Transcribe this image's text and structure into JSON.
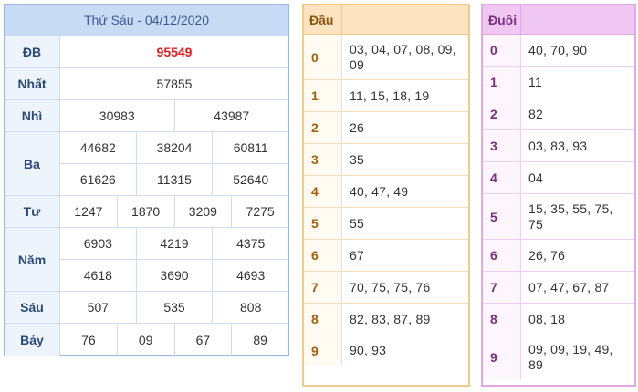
{
  "results": {
    "title": "Thứ Sáu - 04/12/2020",
    "prizes": [
      {
        "label": "ĐB",
        "rows": [
          [
            "95549"
          ]
        ]
      },
      {
        "label": "Nhất",
        "rows": [
          [
            "57855"
          ]
        ]
      },
      {
        "label": "Nhì",
        "rows": [
          [
            "30983",
            "43987"
          ]
        ]
      },
      {
        "label": "Ba",
        "rows": [
          [
            "44682",
            "38204",
            "60811"
          ],
          [
            "61626",
            "11315",
            "52640"
          ]
        ]
      },
      {
        "label": "Tư",
        "rows": [
          [
            "1247",
            "1870",
            "3209",
            "7275"
          ]
        ]
      },
      {
        "label": "Năm",
        "rows": [
          [
            "6903",
            "4219",
            "4375"
          ],
          [
            "4618",
            "3690",
            "4693"
          ]
        ]
      },
      {
        "label": "Sáu",
        "rows": [
          [
            "507",
            "535",
            "808"
          ]
        ]
      },
      {
        "label": "Bảy",
        "rows": [
          [
            "76",
            "09",
            "67",
            "89"
          ]
        ]
      }
    ]
  },
  "dau": {
    "header": "Đầu",
    "rows": [
      {
        "key": "0",
        "values": "03, 04, 07, 08, 09, 09"
      },
      {
        "key": "1",
        "values": "11, 15, 18, 19"
      },
      {
        "key": "2",
        "values": "26"
      },
      {
        "key": "3",
        "values": "35"
      },
      {
        "key": "4",
        "values": "40, 47, 49"
      },
      {
        "key": "5",
        "values": "55"
      },
      {
        "key": "6",
        "values": "67"
      },
      {
        "key": "7",
        "values": "70, 75, 75, 76"
      },
      {
        "key": "8",
        "values": "82, 83, 87, 89"
      },
      {
        "key": "9",
        "values": "90, 93"
      }
    ]
  },
  "duoi": {
    "header": "Đuôi",
    "rows": [
      {
        "key": "0",
        "values": "40, 70, 90"
      },
      {
        "key": "1",
        "values": "11"
      },
      {
        "key": "2",
        "values": "82"
      },
      {
        "key": "3",
        "values": "03, 83, 93"
      },
      {
        "key": "4",
        "values": "04"
      },
      {
        "key": "5",
        "values": "15, 35, 55, 75, 75"
      },
      {
        "key": "6",
        "values": "26, 76"
      },
      {
        "key": "7",
        "values": "07, 47, 67, 87"
      },
      {
        "key": "8",
        "values": "08, 18"
      },
      {
        "key": "9",
        "values": "09, 09, 19, 49, 89"
      }
    ]
  },
  "colors": {
    "special_prize": "#e21d1d",
    "results_header_bg": "#c8dbf4",
    "dau_border": "#f3c88b",
    "duoi_border": "#e2a9e6"
  }
}
